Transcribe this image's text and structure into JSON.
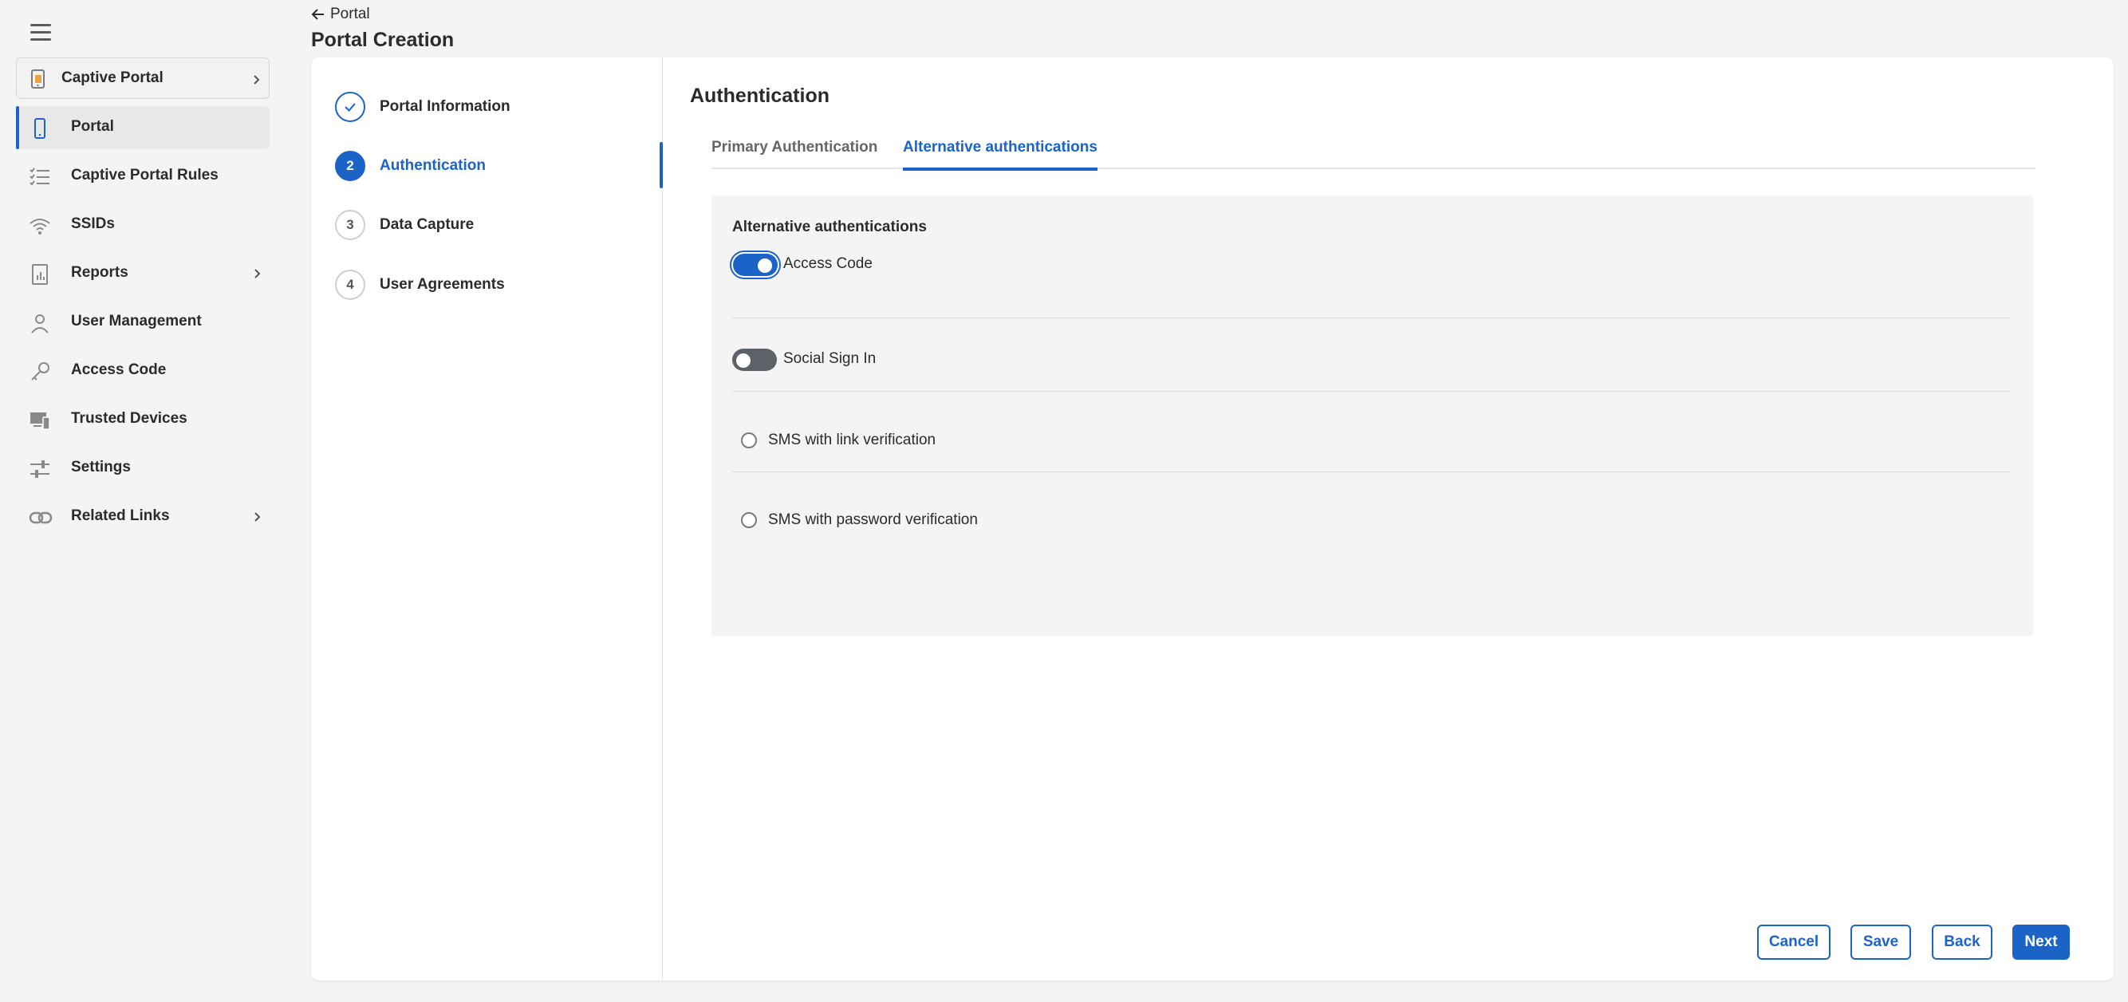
{
  "sidebar": {
    "header": {
      "label": "Captive Portal",
      "icon": "captive-portal-icon"
    },
    "items": [
      {
        "label": "Portal",
        "icon": "phone-icon",
        "active": true
      },
      {
        "label": "Captive Portal Rules",
        "icon": "checklist-icon"
      },
      {
        "label": "SSIDs",
        "icon": "wifi-icon"
      },
      {
        "label": "Reports",
        "icon": "report-icon",
        "has_children": true
      },
      {
        "label": "User Management",
        "icon": "user-icon"
      },
      {
        "label": "Access Code",
        "icon": "key-icon"
      },
      {
        "label": "Trusted Devices",
        "icon": "devices-icon"
      },
      {
        "label": "Settings",
        "icon": "sliders-icon"
      },
      {
        "label": "Related Links",
        "icon": "link-icon",
        "has_children": true
      }
    ]
  },
  "header": {
    "back_label": "Portal",
    "title": "Portal Creation"
  },
  "stepper": {
    "steps": [
      {
        "number": "",
        "label": "Portal Information",
        "state": "done"
      },
      {
        "number": "2",
        "label": "Authentication",
        "state": "active"
      },
      {
        "number": "3",
        "label": "Data Capture",
        "state": "pending"
      },
      {
        "number": "4",
        "label": "User Agreements",
        "state": "pending"
      }
    ]
  },
  "content": {
    "title": "Authentication",
    "tabs": [
      {
        "label": "Primary Authentication",
        "active": false
      },
      {
        "label": "Alternative authentications",
        "active": true
      }
    ],
    "panel": {
      "title": "Alternative authentications",
      "options": [
        {
          "label": "Access Code",
          "type": "toggle",
          "checked": true
        },
        {
          "label": "Social Sign In",
          "type": "toggle",
          "checked": false
        },
        {
          "label": "SMS with link verification",
          "type": "radio",
          "checked": false
        },
        {
          "label": "SMS with password verification",
          "type": "radio",
          "checked": false
        }
      ]
    }
  },
  "footer": {
    "cancel": "Cancel",
    "save": "Save",
    "back": "Back",
    "next": "Next"
  },
  "colors": {
    "accent": "#1c63c8",
    "background": "#f4f4f4",
    "toggle_off": "#5d6168"
  }
}
